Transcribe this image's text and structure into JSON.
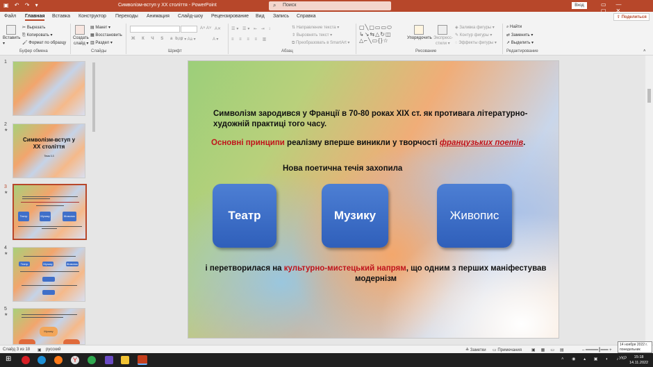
{
  "titlebar": {
    "doc_title": "Символізм-вступ у XX століття  -  PowerPoint",
    "search_placeholder": "Поиск",
    "login_label": "Вход"
  },
  "menu": {
    "tabs": [
      "Файл",
      "Главная",
      "Вставка",
      "Конструктор",
      "Переходы",
      "Анимация",
      "Слайд-шоу",
      "Рецензирование",
      "Вид",
      "Запись",
      "Справка"
    ],
    "active": "Главная",
    "share_label": "Поделиться"
  },
  "ribbon": {
    "clipboard": {
      "paste": "Вставить",
      "cut": "Вырезать",
      "copy": "Копировать",
      "format": "Формат по образцу",
      "label": "Буфер обмена"
    },
    "slides": {
      "new_slide": "Создать",
      "new_slide2": "слайд",
      "layout": "Макет",
      "reset": "Восстановить",
      "section": "Раздел",
      "label": "Слайды"
    },
    "font": {
      "label": "Шрифт"
    },
    "paragraph": {
      "text_direction": "Направление текста",
      "align_text": "Выровнять текст",
      "smartart": "Преобразовать в SmartArt",
      "label": "Абзац"
    },
    "drawing": {
      "arrange": "Упорядочить",
      "quick_styles": "Экспресс-",
      "quick_styles2": "стили",
      "fill": "Заливка фигуры",
      "outline": "Контур фигуры",
      "effects": "Эффекты фигуры",
      "label": "Рисование"
    },
    "editing": {
      "find": "Найти",
      "replace": "Заменить",
      "select": "Выделить",
      "label": "Редактирование"
    }
  },
  "thumbnails": {
    "numbers": [
      "1",
      "2",
      "3",
      "4",
      "5"
    ],
    "slide2_title": "Символізм-вступ у XX століття",
    "slide2_subtitle": "Тема 3.3",
    "slide3_boxes": [
      "Театр",
      "Музику",
      "Живопис"
    ],
    "slide4_boxes": [
      "Театр",
      "Музику",
      "Живопис"
    ],
    "slide5_box": "Музику"
  },
  "slide": {
    "line1": "Символізм зародився у Франції в 70-80 роках XIX ст. як противага літературно-художній  практиці того часу.",
    "line2_a": "Основні принципи",
    "line2_b": " реалізму вперше виникли у творчості ",
    "line2_c": "французьких поетів",
    "line2_d": ".",
    "line3": "Нова поетична течія захопила",
    "boxes": [
      "Театр",
      "Музику",
      "Живопис"
    ],
    "line4_a": "і перетворилася на ",
    "line4_b": "культурно-мистецький напрям",
    "line4_c": ", що одним з перших маніфестував модернізм"
  },
  "status": {
    "slide_info": "Слайд 3 из 18",
    "language": "русский",
    "notes": "Заметки",
    "comments": "Примечания"
  },
  "date_tip": {
    "line1": "14 ноября 2022 г.",
    "line2": "понедельник"
  },
  "clock": {
    "time": "15:18",
    "date": "14.11.2022"
  },
  "tray": {
    "lang": "УКР"
  }
}
